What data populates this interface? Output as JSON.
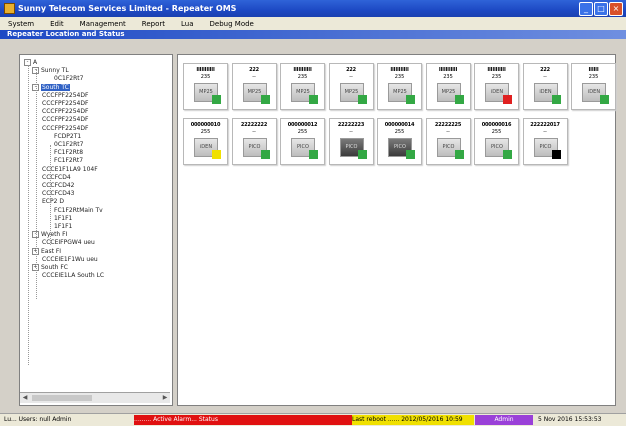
{
  "window": {
    "title": "Sunny Telecom Services Limited - Repeater OMS",
    "controls": [
      "_",
      "□",
      "×"
    ]
  },
  "menu": [
    "System",
    "Edit",
    "Management",
    "Report",
    "Lua",
    "Debug Mode"
  ],
  "panel_title": "Repeater Location and Status",
  "tree": [
    {
      "label": "A",
      "level": 0,
      "toggle": "-"
    },
    {
      "label": "Sunny TL",
      "level": 1,
      "toggle": "-"
    },
    {
      "label": "0C1F2Rt7",
      "level": 3
    },
    {
      "label": "South TC",
      "level": 1,
      "toggle": "-",
      "selected": true
    },
    {
      "label": "CCCFPF2254DF",
      "level": 2
    },
    {
      "label": "CCCFPF2254DF",
      "level": 2
    },
    {
      "label": "CCCFPF2254DF",
      "level": 2
    },
    {
      "label": "CCCFPF2254DF",
      "level": 2
    },
    {
      "label": "CCCFPF2254DF",
      "level": 2
    },
    {
      "label": "FCDP2T1",
      "level": 3
    },
    {
      "label": "0C1F2Rt7",
      "level": 3
    },
    {
      "label": "FC1F2Rt8",
      "level": 3
    },
    {
      "label": "FC1F2Rt7",
      "level": 3
    },
    {
      "label": "CCCE1F1LA9 104F",
      "level": 2
    },
    {
      "label": "CCCFCD4",
      "level": 2
    },
    {
      "label": "CCCFCD42",
      "level": 2
    },
    {
      "label": "CCCFCD43",
      "level": 2
    },
    {
      "label": "ECP2 D",
      "level": 2
    },
    {
      "label": "FC1F2RtMain Tv",
      "level": 3
    },
    {
      "label": "1F1F1",
      "level": 3
    },
    {
      "label": "1F1F1",
      "level": 3
    },
    {
      "label": "Wyeth FI",
      "level": 1,
      "toggle": "-"
    },
    {
      "label": "CCCEIFPGW4 ueu",
      "level": 2
    },
    {
      "label": "East FI",
      "level": 1,
      "toggle": "+"
    },
    {
      "label": "CCCEIE1F1Wu ueu",
      "level": 2
    },
    {
      "label": "South FC",
      "level": 1,
      "toggle": "+"
    },
    {
      "label": "CCCEIE1LA South LC",
      "level": 2
    }
  ],
  "tiles": [
    {
      "id": "IIIIIIIIIII",
      "ch": "235",
      "img": "MP25",
      "status": "#33a844"
    },
    {
      "id": "222",
      "ch": "--",
      "img": "MP25",
      "status": "#33a844"
    },
    {
      "id": "IIIIIIIIIII",
      "ch": "235",
      "img": "MP25",
      "status": "#33a844"
    },
    {
      "id": "222",
      "ch": "--",
      "img": "MP25",
      "status": "#33a844"
    },
    {
      "id": "IIIIIIIIIII",
      "ch": "235",
      "img": "MP25",
      "status": "#33a844"
    },
    {
      "id": "IIIIIIIIIII",
      "ch": "235",
      "img": "MP25",
      "status": "#33a844"
    },
    {
      "id": "IIIIIIIIIII",
      "ch": "235",
      "img": "iDEN",
      "status": "#e02020"
    },
    {
      "id": "222",
      "ch": "--",
      "img": "iDEN",
      "status": "#33a844"
    },
    {
      "id": "IIIIII",
      "ch": "235",
      "img": "iDEN",
      "status": "#33a844"
    },
    {
      "id": "000000010",
      "ch": "255",
      "img": "iDEN",
      "status": "#f0e000"
    },
    {
      "id": "22222222",
      "ch": "--",
      "img": "PICO",
      "status": "#33a844"
    },
    {
      "id": "000000012",
      "ch": "255",
      "img": "PICO",
      "status": "#33a844"
    },
    {
      "id": "22222223",
      "ch": "--",
      "img": "PICO",
      "status": "#33a844",
      "dark": true
    },
    {
      "id": "000000014",
      "ch": "255",
      "img": "PICO",
      "status": "#33a844",
      "dark": true
    },
    {
      "id": "22222225",
      "ch": "--",
      "img": "PICO",
      "status": "#33a844"
    },
    {
      "id": "000000016",
      "ch": "255",
      "img": "PICO",
      "status": "#33a844"
    },
    {
      "id": "222222017",
      "ch": "--",
      "img": "PICO",
      "status": "#000000"
    }
  ],
  "statusbar": {
    "left_text": "Lu... Users: null Admin",
    "alarm_text": "......... Active Alarm... Status",
    "alarm_color": "#e01010",
    "last_reboot_text": "Last reboot ...... 2012/05/2016 10:59",
    "last_reboot_color": "#f0e000",
    "admin_text": "Admin",
    "admin_color": "#9a40d8",
    "clock_text": "5 Nov 2016 15:53:53"
  }
}
